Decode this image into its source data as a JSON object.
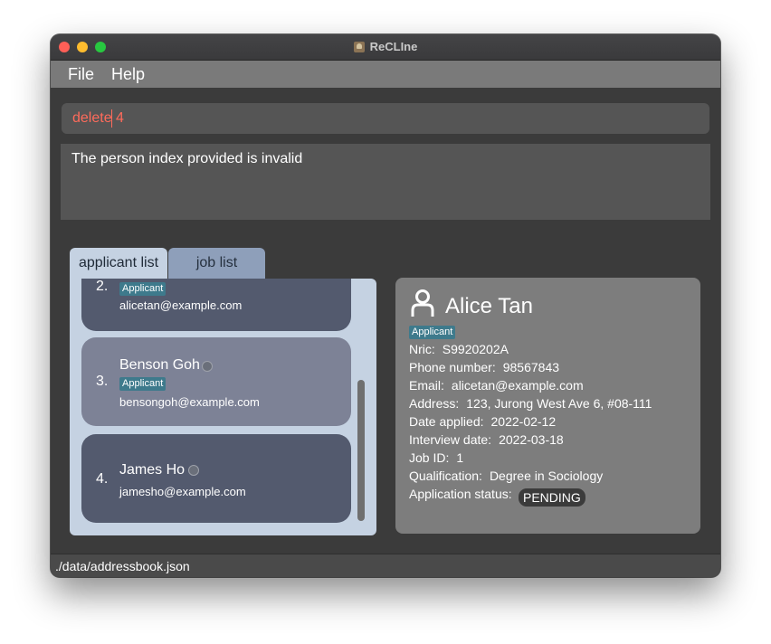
{
  "window": {
    "title": "ReCLIne"
  },
  "menu": {
    "file": "File",
    "help": "Help"
  },
  "command": {
    "value": "delete 4"
  },
  "result": {
    "message": "The person index provided is invalid"
  },
  "tabs": {
    "applicant": "applicant list",
    "job": "job list"
  },
  "list": {
    "items": [
      {
        "index": "2.",
        "name": "",
        "tag": "Applicant",
        "email": "alicetan@example.com"
      },
      {
        "index": "3.",
        "name": "Benson Goh",
        "tag": "Applicant",
        "email": "bensongoh@example.com"
      },
      {
        "index": "4.",
        "name": "James Ho",
        "tag": "",
        "email": "jamesho@example.com"
      }
    ]
  },
  "detail": {
    "name": "Alice Tan",
    "tag": "Applicant",
    "fields": [
      {
        "label": "Nric:",
        "value": "S9920202A"
      },
      {
        "label": "Phone number:",
        "value": "98567843"
      },
      {
        "label": "Email:",
        "value": "alicetan@example.com"
      },
      {
        "label": "Address:",
        "value": "123, Jurong West Ave 6, #08-111"
      },
      {
        "label": "Date applied:",
        "value": "2022-02-12"
      },
      {
        "label": "Interview date:",
        "value": "2022-03-18"
      },
      {
        "label": "Job ID:",
        "value": "1"
      },
      {
        "label": "Qualification:",
        "value": "Degree in Sociology"
      }
    ],
    "status_label": "Application status:",
    "status_value": "PENDING"
  },
  "statusbar": {
    "path": "./data/addressbook.json"
  },
  "colors": {
    "tag_bg": "#3e7a8c",
    "command_text": "#ff6b5b",
    "list_bg": "#c5d2e2",
    "card_dark": "#535a6e",
    "card_selected": "#7d8296"
  }
}
